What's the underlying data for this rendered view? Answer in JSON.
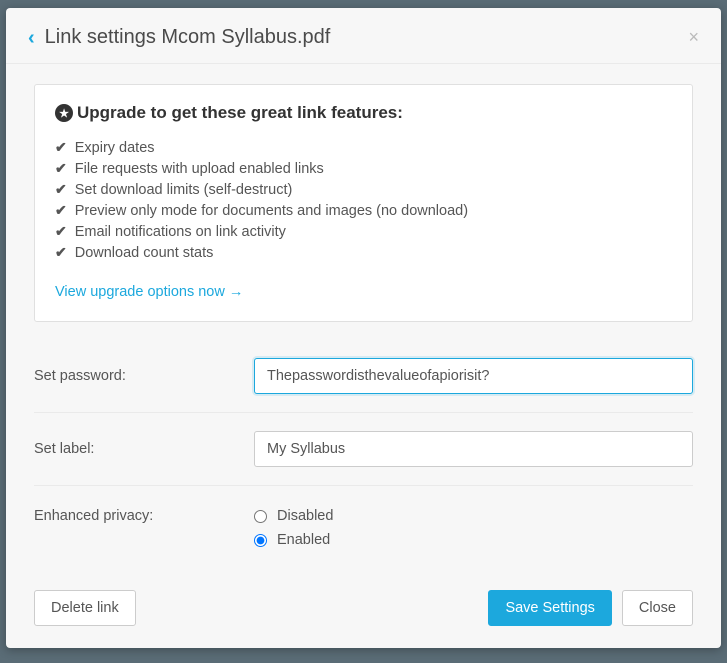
{
  "header": {
    "title": "Link settings Mcom Syllabus.pdf"
  },
  "upgrade": {
    "heading": "Upgrade to get these great link features:",
    "features": [
      "Expiry dates",
      "File requests with upload enabled links",
      "Set download limits (self-destruct)",
      "Preview only mode for documents and images (no download)",
      "Email notifications on link activity",
      "Download count stats"
    ],
    "link_text": "View upgrade options now"
  },
  "form": {
    "password_label": "Set password:",
    "password_value": "Thepasswordisthevalueofapiorisit?",
    "label_label": "Set label:",
    "label_value": "My Syllabus",
    "privacy_label": "Enhanced privacy:",
    "privacy_options": {
      "disabled": "Disabled",
      "enabled": "Enabled"
    },
    "privacy_selected": "enabled"
  },
  "footer": {
    "delete": "Delete link",
    "save": "Save Settings",
    "close": "Close"
  }
}
